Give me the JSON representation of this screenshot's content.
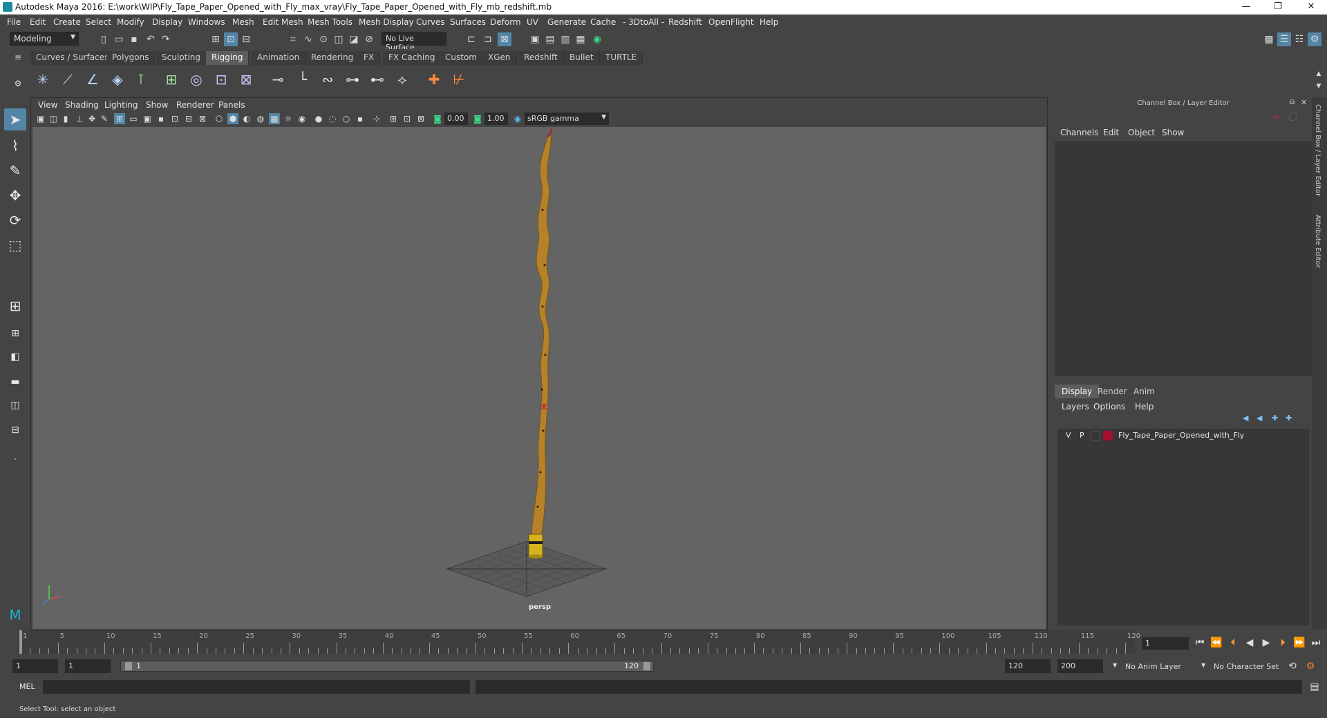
{
  "window": {
    "title": "Autodesk Maya 2016: E:\\work\\WIP\\Fly_Tape_Paper_Opened_with_Fly_max_vray\\Fly_Tape_Paper_Opened_with_Fly_mb_redshift.mb",
    "minimize": "—",
    "maximize": "❐",
    "close": "✕"
  },
  "menubar": [
    "File",
    "Edit",
    "Create",
    "Select",
    "Modify",
    "Display",
    "Windows",
    "Mesh",
    "Edit Mesh",
    "Mesh Tools",
    "Mesh Display",
    "Curves",
    "Surfaces",
    "Deform",
    "UV",
    "Generate",
    "Cache",
    "- 3DtoAll -",
    "Redshift",
    "OpenFlight",
    "Help"
  ],
  "status": {
    "mode": "Modeling",
    "live_surface": "No Live Surface"
  },
  "shelf_tabs": [
    "Curves / Surfaces",
    "Polygons",
    "Sculpting",
    "Rigging",
    "Animation",
    "Rendering",
    "FX",
    "FX Caching",
    "Custom",
    "XGen",
    "Redshift",
    "Bullet",
    "TURTLE"
  ],
  "shelf_active": "Rigging",
  "viewport": {
    "menus": [
      "View",
      "Shading",
      "Lighting",
      "Show",
      "Renderer",
      "Panels"
    ],
    "exposure": "0.00",
    "gamma": "1.00",
    "color_space": "sRGB gamma",
    "camera_label": "persp"
  },
  "channel_box": {
    "title": "Channel Box / Layer Editor",
    "menus": [
      "Channels",
      "Edit",
      "Object",
      "Show"
    ],
    "tabs": [
      "Display",
      "Render",
      "Anim"
    ],
    "active_tab": "Display",
    "layer_menus": [
      "Layers",
      "Options",
      "Help"
    ],
    "layer": {
      "v": "V",
      "p": "P",
      "name": "Fly_Tape_Paper_Opened_with_Fly",
      "color": "#a3102c"
    }
  },
  "side_tabs": [
    "Channel Box / Layer Editor",
    "Attribute Editor"
  ],
  "timeline": {
    "ticks": [
      "1",
      "5",
      "10",
      "15",
      "20",
      "25",
      "30",
      "35",
      "40",
      "45",
      "50",
      "55",
      "60",
      "65",
      "70",
      "75",
      "80",
      "85",
      "90",
      "95",
      "100",
      "105",
      "110",
      "115",
      "120"
    ],
    "current_frame": "1"
  },
  "range": {
    "start": "1",
    "playback_start": "1",
    "slider_start": "1",
    "slider_end": "120",
    "playback_end": "120",
    "end": "200",
    "anim_layer": "No Anim Layer",
    "character_set": "No Character Set"
  },
  "command": {
    "label": "MEL",
    "help": "Select Tool: select an object"
  },
  "colors": {
    "tape": "#b5822a",
    "accent": "#5285a6",
    "layer_color": "#a3102c"
  }
}
